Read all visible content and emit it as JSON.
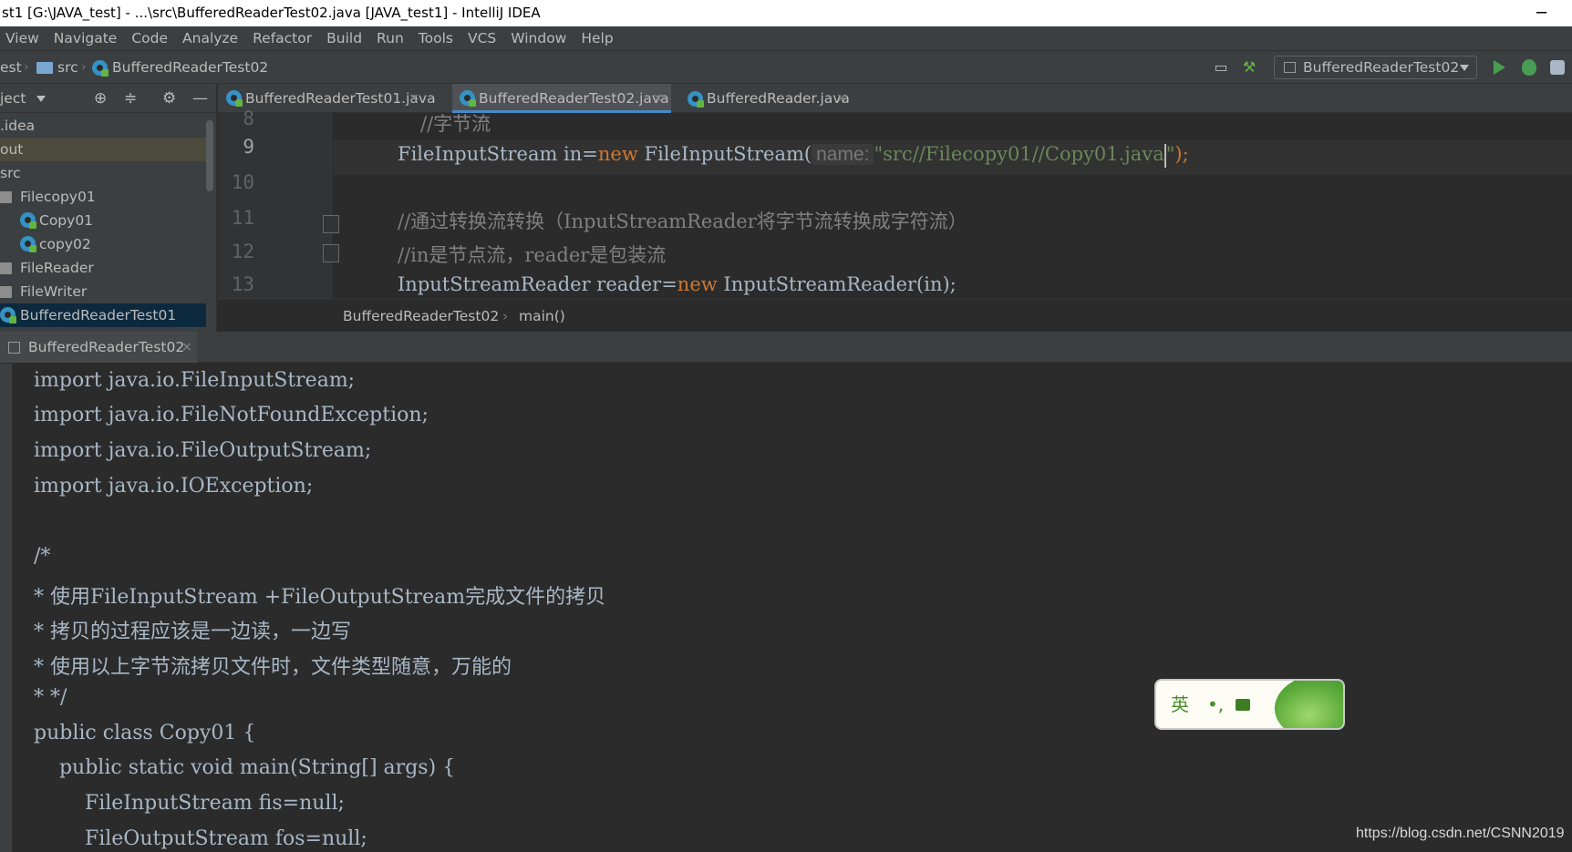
{
  "window": {
    "title": "st1 [G:\\JAVA_test] - ...\\src\\BufferedReaderTest02.java [JAVA_test1] - IntelliJ IDEA",
    "minimize_glyph": "─"
  },
  "menu": [
    "View",
    "Navigate",
    "Code",
    "Analyze",
    "Refactor",
    "Build",
    "Run",
    "Tools",
    "VCS",
    "Window",
    "Help"
  ],
  "navbar": {
    "crumbs": [
      "est",
      "src",
      "BufferedReaderTest02"
    ],
    "run_config": "BufferedReaderTest02"
  },
  "project": {
    "title": "ject",
    "tree": [
      {
        "label": ".idea",
        "type": "folder"
      },
      {
        "label": "out",
        "type": "folder"
      },
      {
        "label": "src",
        "type": "folder"
      },
      {
        "label": "Filecopy01",
        "type": "package"
      },
      {
        "label": "Copy01",
        "type": "class"
      },
      {
        "label": "copy02",
        "type": "class"
      },
      {
        "label": "FileReader",
        "type": "package"
      },
      {
        "label": "FileWriter",
        "type": "package"
      },
      {
        "label": "BufferedReaderTest01",
        "type": "class"
      }
    ]
  },
  "editor": {
    "tabs": [
      {
        "label": "BufferedReaderTest01.java",
        "active": false
      },
      {
        "label": "BufferedReaderTest02.java",
        "active": true
      },
      {
        "label": "BufferedReader.java",
        "active": false
      }
    ],
    "close_glyph": "×",
    "line_numbers": [
      "8",
      "9",
      "10",
      "11",
      "12",
      "13"
    ],
    "lines": {
      "l8": "//字节流",
      "l9_a": "FileInputStream in=",
      "l9_new": "new",
      "l9_b": " FileInputStream(",
      "l9_hint": "name:",
      "l9_str_a": "\"src//Filecopy01//Copy01.java",
      "l9_str_b": "\"",
      "l9_end": ");",
      "l11": "//通过转换流转换（InputStreamReader将字节流转换成字符流）",
      "l12": "//in是节点流，reader是包装流",
      "l13_a": "InputStreamReader reader=",
      "l13_new": "new",
      "l13_b": " InputStreamReader(in);"
    },
    "breadcrumb": [
      "BufferedReaderTest02",
      "main()"
    ]
  },
  "lower": {
    "tab_label": "BufferedReaderTest02",
    "lines": [
      "import java.io.FileInputStream;",
      "import java.io.FileNotFoundException;",
      "import java.io.FileOutputStream;",
      "import java.io.IOException;",
      "",
      "/*",
      "* 使用FileInputStream +FileOutputStream完成文件的拷贝",
      "* 拷贝的过程应该是一边读，一边写",
      "* 使用以上字节流拷贝文件时，文件类型随意，万能的",
      "* */",
      "public class Copy01 {",
      "    public static void main(String[] args) {",
      "        FileInputStream fis=null;",
      "        FileOutputStream fos=null;"
    ]
  },
  "ime": {
    "lang": "英",
    "punct": "•,"
  },
  "watermark": "https://blog.csdn.net/CSNN2019",
  "colors": {
    "keyword": "#cc7832",
    "string": "#6a8759",
    "comment": "#808080",
    "text": "#a9b7c6"
  }
}
